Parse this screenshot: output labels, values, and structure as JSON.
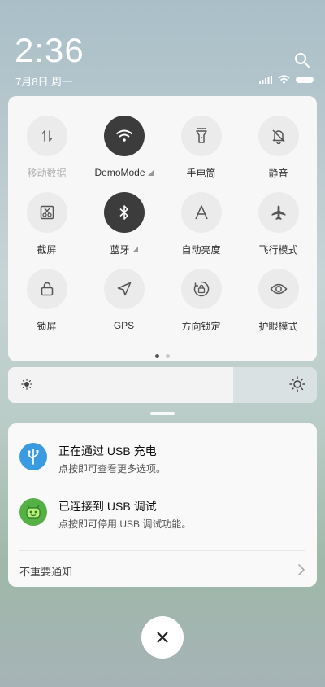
{
  "status": {
    "time": "2:36",
    "date": "7月8日 周一"
  },
  "quick_settings": {
    "tiles": [
      {
        "label": "移动数据",
        "icon": "mobile-data-icon",
        "active": false,
        "disabled": true
      },
      {
        "label": "DemoMode",
        "icon": "wifi-icon",
        "active": true,
        "disabled": false
      },
      {
        "label": "手电筒",
        "icon": "flashlight-icon",
        "active": false,
        "disabled": false
      },
      {
        "label": "静音",
        "icon": "mute-bell-icon",
        "active": false,
        "disabled": false
      },
      {
        "label": "截屏",
        "icon": "screenshot-icon",
        "active": false,
        "disabled": false
      },
      {
        "label": "蓝牙",
        "icon": "bluetooth-icon",
        "active": true,
        "disabled": false
      },
      {
        "label": "自动亮度",
        "icon": "auto-brightness-icon",
        "active": false,
        "disabled": false
      },
      {
        "label": "飞行模式",
        "icon": "airplane-icon",
        "active": false,
        "disabled": false
      },
      {
        "label": "锁屏",
        "icon": "lock-icon",
        "active": false,
        "disabled": false
      },
      {
        "label": "GPS",
        "icon": "location-arrow-icon",
        "active": false,
        "disabled": false
      },
      {
        "label": "方向锁定",
        "icon": "rotation-lock-icon",
        "active": false,
        "disabled": false
      },
      {
        "label": "护眼模式",
        "icon": "eye-icon",
        "active": false,
        "disabled": false
      }
    ],
    "page_count": 2,
    "current_page": 1
  },
  "brightness": {
    "level": 0.73
  },
  "notifications": {
    "items": [
      {
        "title": "正在通过 USB 充电",
        "text": "点按即可查看更多选项。",
        "icon": "usb-icon",
        "icon_color": "#3a9be0"
      },
      {
        "title": "已连接到 USB 调试",
        "text": "点按即可停用 USB 调试功能。",
        "icon": "android-icon",
        "icon_color": "#55b046"
      }
    ],
    "unimportant_label": "不重要通知"
  },
  "colors": {
    "tile_active": "#3c3c3c",
    "tile_inactive": "#ebebeb"
  }
}
